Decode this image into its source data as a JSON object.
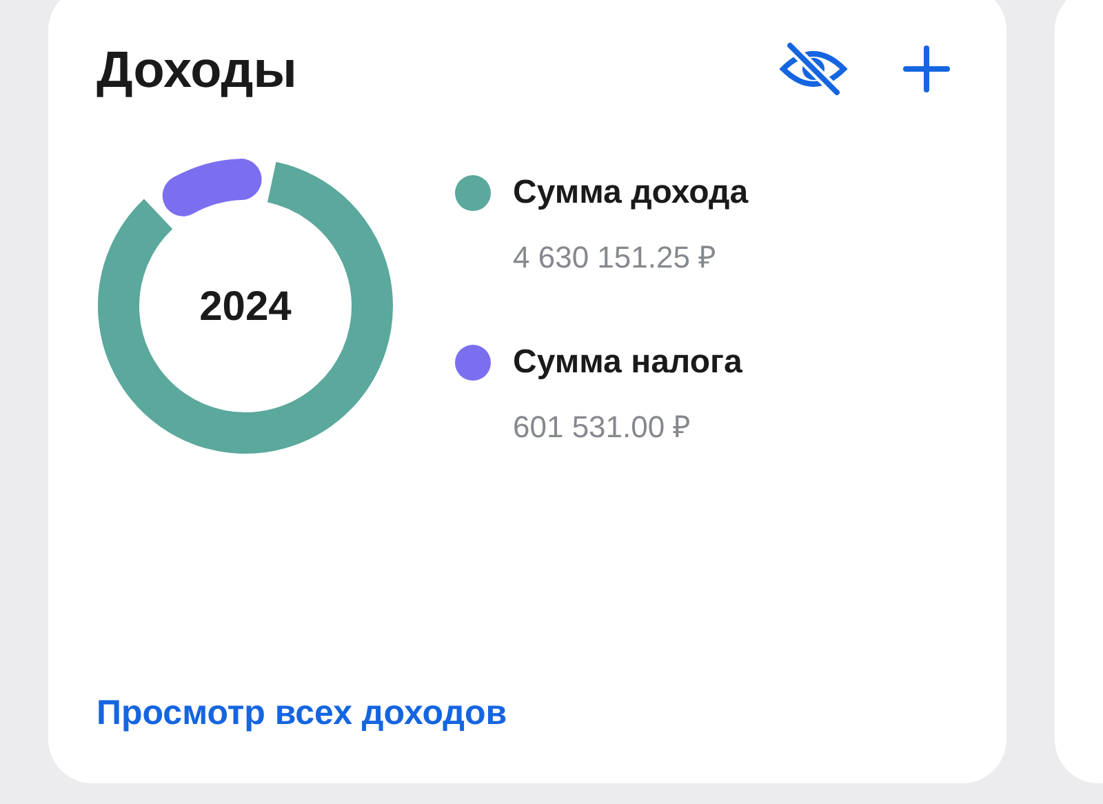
{
  "card": {
    "title": "Доходы",
    "center_label": "2024",
    "legend": [
      {
        "label": "Сумма дохода",
        "amount": "4 630 151.25 ₽",
        "color": "#5ba89c"
      },
      {
        "label": "Сумма налога",
        "amount": "601 531.00 ₽",
        "color": "#7b6ff0"
      }
    ],
    "link": "Просмотр всех доходов"
  }
}
